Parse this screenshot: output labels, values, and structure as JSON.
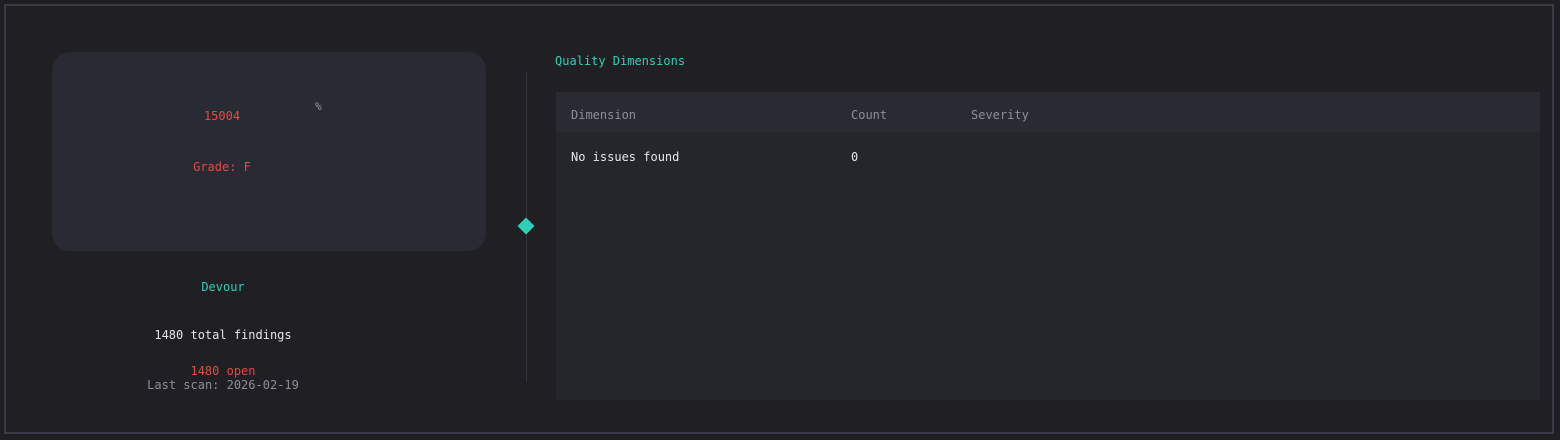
{
  "score_card": {
    "value": "15004",
    "percent_symbol": "%",
    "grade": "Grade: F"
  },
  "project": {
    "name": "Devour",
    "total_findings": "1480 total findings",
    "open": "1480 open",
    "last_scan": "Last scan: 2026-02-19"
  },
  "quality": {
    "title": "Quality Dimensions",
    "columns": [
      "Dimension",
      "Count",
      "Severity"
    ],
    "rows": [
      {
        "dimension": "No issues found",
        "count": "0",
        "severity": ""
      }
    ]
  },
  "colors": {
    "accent": "#2fd0b8",
    "danger": "#e74a3f",
    "background": "#1f1f24",
    "card": "#292a33"
  },
  "icons": {
    "timeline_marker": "diamond-icon"
  }
}
